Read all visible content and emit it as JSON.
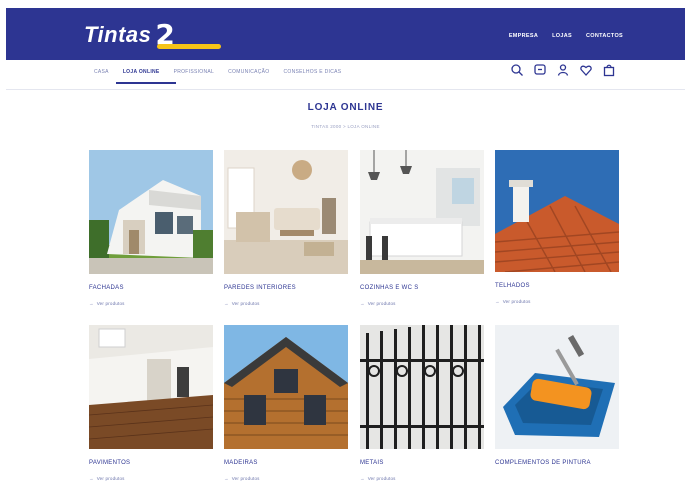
{
  "brand": {
    "name": "Tintas",
    "badge": "2000"
  },
  "top_nav": [
    "EMPRESA",
    "LOJAS",
    "CONTACTOS"
  ],
  "main_nav": [
    {
      "label": "CASA",
      "active": false
    },
    {
      "label": "LOJA ONLINE",
      "active": true
    },
    {
      "label": "PROFISSIONAL",
      "active": false
    },
    {
      "label": "COMUNICAÇÃO",
      "active": false
    },
    {
      "label": "CONSELHOS E DICAS",
      "active": false
    }
  ],
  "header_icons": [
    "search-icon",
    "chat-icon",
    "user-icon",
    "heart-icon",
    "bag-icon"
  ],
  "page": {
    "title": "LOJA ONLINE",
    "breadcrumb": "TINTAS 2000 > LOJA ONLINE"
  },
  "categories": [
    {
      "name": "FACHADAS",
      "link": "Ver produtos"
    },
    {
      "name": "PAREDES INTERIORES",
      "link": "Ver produtos"
    },
    {
      "name": "COZINHAS E WC S",
      "link": "Ver produtos"
    },
    {
      "name": "TELHADOS",
      "link": "Ver produtos"
    },
    {
      "name": "PAVIMENTOS",
      "link": "Ver produtos"
    },
    {
      "name": "MADEIRAS",
      "link": "Ver produtos"
    },
    {
      "name": "METAIS",
      "link": "Ver produtos"
    },
    {
      "name": "COMPLEMENTOS DE PINTURA",
      "link": "Ver produtos"
    }
  ],
  "colors": {
    "brand_blue": "#2d3592",
    "accent_red": "#e3342b",
    "accent_yellow": "#f6c418"
  }
}
